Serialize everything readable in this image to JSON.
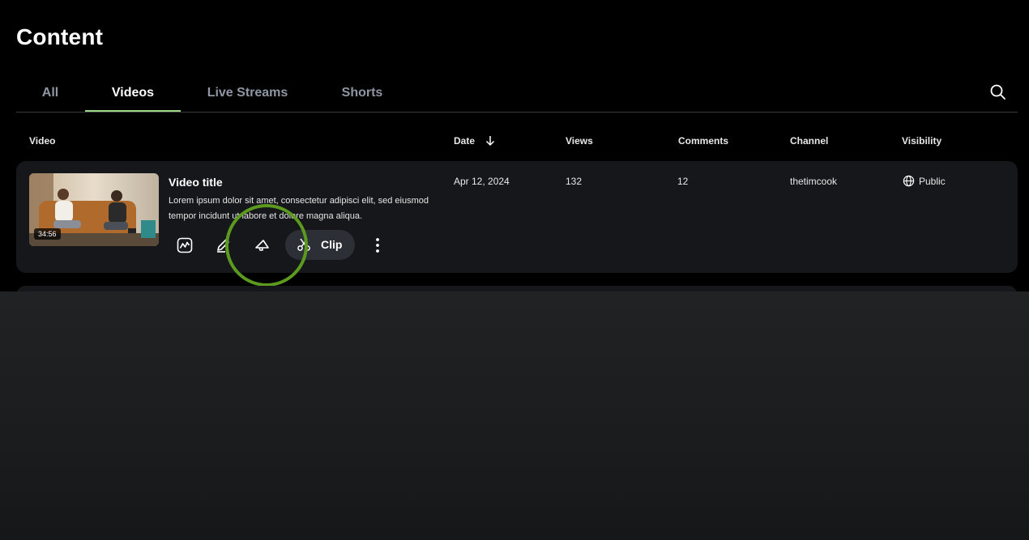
{
  "page": {
    "title": "Content"
  },
  "tabs": [
    {
      "label": "All",
      "active": false
    },
    {
      "label": "Videos",
      "active": true
    },
    {
      "label": "Live Streams",
      "active": false
    },
    {
      "label": "Shorts",
      "active": false
    }
  ],
  "table": {
    "columns": {
      "video": "Video",
      "date": "Date",
      "views": "Views",
      "comments": "Comments",
      "channel": "Channel",
      "visibility": "Visibility"
    },
    "rows": [
      {
        "title": "Video title",
        "description": "Lorem ipsum dolor sit amet, consectetur adipisci elit, sed eiusmod tempor incidunt ut labore et dolore magna aliqua.",
        "duration": "34:56",
        "date": "Apr 12, 2024",
        "views": "132",
        "comments": "12",
        "channel": "thetimcook",
        "visibility": "Public",
        "clip_label": "Clip"
      }
    ]
  },
  "colors": {
    "accent_tab_underline": "#9bd88a",
    "highlight_ring": "#5b9a1e",
    "card_background": "#15171a"
  },
  "icons": [
    "search-icon",
    "sort-down-arrow-icon",
    "analytics-icon",
    "edit-icon",
    "promote-megaphone-icon",
    "scissors-icon",
    "more-vertical-icon",
    "globe-icon"
  ]
}
